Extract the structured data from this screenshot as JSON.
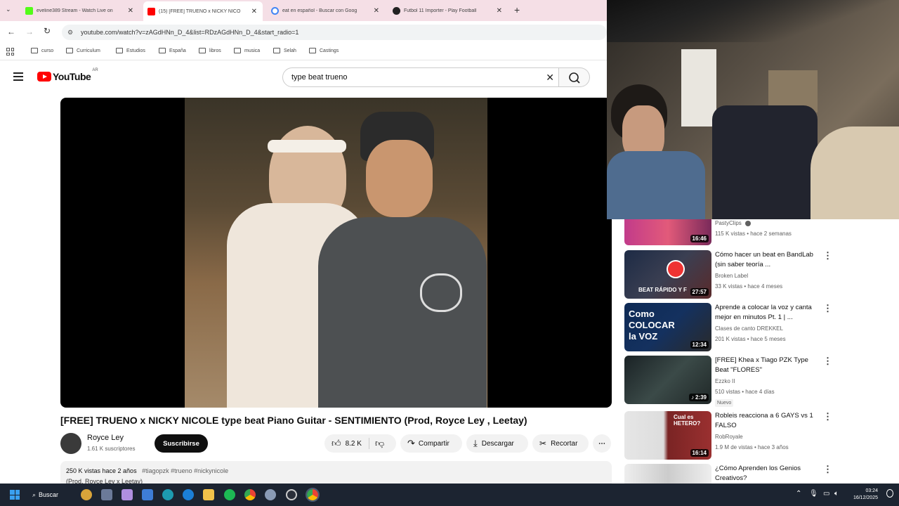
{
  "browser": {
    "tabs": [
      {
        "label": "eveline389 Stream - Watch Live on",
        "color": "#53fc18"
      },
      {
        "label": "(15) [FREE] TRUENO x NICKY NICO",
        "color": "#ff0000"
      },
      {
        "label": "eat en español - Buscar con Goog",
        "color": "#4285f4"
      },
      {
        "label": "Futbol 11 Importer - Play Football",
        "color": "#222222"
      }
    ],
    "url": "youtube.com/watch?v=zAGdHNn_D_4&list=RDzAGdHNn_D_4&start_radio=1",
    "bookmarks": [
      "curso",
      "Curriculum",
      "Estudios",
      "España",
      "libros",
      "musica",
      "Selah",
      "Castings"
    ]
  },
  "youtube": {
    "logo_text": "YouTube",
    "country_code": "AR",
    "search_value": "type beat trueno",
    "video": {
      "title": "[FREE] TRUENO x NICKY NICOLE type beat Piano Guitar - SENTIMIENTO (Prod, Royce Ley , Leetay)",
      "channel": "Royce Ley",
      "subscribers": "1.61 K suscriptores",
      "subscribe_label": "Suscribirse",
      "likes": "8.2 K",
      "share_label": "Compartir",
      "download_label": "Descargar",
      "clip_label": "Recortar",
      "description_stats": "250 K vistas  hace 2 años",
      "description_tags": "#tiagopzk #trueno #nickynicole",
      "description_text": "(Prod. Royce Ley x Leetay)"
    },
    "recommendations": [
      {
        "title": "",
        "channel": "PastyClips",
        "stats": "115 K vistas • hace 2 semanas",
        "duration": "16:46"
      },
      {
        "title": "Cómo hacer un beat en BandLab (sin saber teoría ...",
        "channel": "Broken Label",
        "stats": "33 K vistas • hace 4 meses",
        "duration": "27:57",
        "thumb_text": "BEAT RÁPIDO Y F"
      },
      {
        "title": "Aprende a colocar la voz y canta mejor en minutos Pt. 1 | ...",
        "channel": "Clases de canto DREKKEL",
        "stats": "201 K vistas • hace 5 meses",
        "duration": "12:34",
        "thumb_text": "Como COLOCAR la VOZ"
      },
      {
        "title": "[FREE] Khea x Tiago PZK Type Beat \"FLORES\"",
        "channel": "Ezzko II",
        "stats": "510 vistas • hace 4 días",
        "duration": "2:39",
        "badge": "Nuevo"
      },
      {
        "title": "Robleis reacciona a 6 GAYS vs 1 FALSO",
        "channel": "RobRoyale",
        "stats": "1.9 M de vistas • hace 3 años",
        "duration": "16:14",
        "thumb_text": "Cual es HETERO?"
      },
      {
        "title": "¿Cómo Aprenden los Genios Creativos?",
        "channel": "",
        "stats": "",
        "duration": ""
      }
    ]
  },
  "taskbar": {
    "search_label": "Buscar",
    "time": "03:24",
    "date": "16/12/2025"
  }
}
